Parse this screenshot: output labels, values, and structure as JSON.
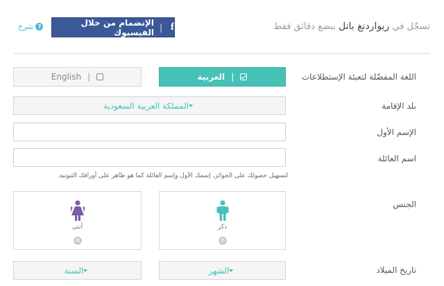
{
  "header": {
    "title_prefix": "تسجّل في",
    "title_brand": "ريواردنغ بانل",
    "title_suffix": "ببضع دقائق فقط",
    "facebook_icon": "f",
    "facebook_label": "الإنضمام من خلال الفيسبوك",
    "help_label": "شرح",
    "help_icon": "?"
  },
  "language": {
    "label": "اللغة المفضّلة لتعبئة الإستطلاعات",
    "arabic": "العربية",
    "english": "English",
    "selected": "arabic"
  },
  "residence": {
    "label": "بلد الإقامة",
    "value": "المملكة العربية السعودية"
  },
  "first_name": {
    "label": "الإسم الأول",
    "value": ""
  },
  "last_name": {
    "label": "اسم العائلة",
    "value": "",
    "hint": "لتسهيل حصولك على الجوائز، إسمك الأول وإسم العائلة كما هو ظاهر على أوراقك الثبوتية."
  },
  "gender": {
    "label": "الجنس",
    "male": "ذكر",
    "female": "أنثى",
    "male_color": "#45c1b5",
    "female_color": "#7b5aa6"
  },
  "birthdate": {
    "label": "تاريخ الميلاد",
    "month": "الشهر",
    "year": "السنة"
  },
  "colors": {
    "accent": "#45c1b5",
    "facebook": "#3b5998",
    "help": "#4cb8d8"
  }
}
